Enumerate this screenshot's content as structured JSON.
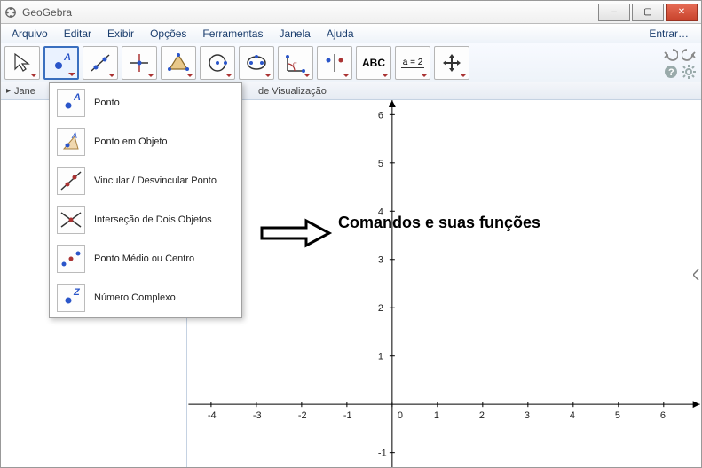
{
  "window": {
    "title": "GeoGebra",
    "min": "–",
    "max": "▢",
    "close": "✕"
  },
  "menu": {
    "items": [
      "Arquivo",
      "Editar",
      "Exibir",
      "Opções",
      "Ferramentas",
      "Janela",
      "Ajuda"
    ],
    "login": "Entrar…"
  },
  "toolbar": {
    "text_btn": "ABC",
    "slider_btn": "a = 2"
  },
  "panels": {
    "left_title": "Jane",
    "right_title": "de Visualização"
  },
  "dropdown": {
    "items": [
      {
        "label": "Ponto",
        "icon": "point"
      },
      {
        "label": "Ponto em Objeto",
        "icon": "point-on-object"
      },
      {
        "label": "Vincular / Desvincular Ponto",
        "icon": "attach"
      },
      {
        "label": "Interseção de Dois Objetos",
        "icon": "intersect"
      },
      {
        "label": "Ponto Médio ou Centro",
        "icon": "midpoint"
      },
      {
        "label": "Número Complexo",
        "icon": "complex"
      }
    ]
  },
  "annotation": {
    "text": "Comandos e suas funções"
  },
  "chart_data": {
    "type": "scatter",
    "title": "",
    "xlabel": "",
    "ylabel": "",
    "xlim": [
      -4.5,
      6.8
    ],
    "ylim": [
      -1.3,
      6.3
    ],
    "xticks": [
      -4,
      -3,
      -2,
      -1,
      0,
      1,
      2,
      3,
      4,
      5,
      6
    ],
    "yticks": [
      -1,
      0,
      1,
      2,
      3,
      4,
      5,
      6
    ],
    "series": []
  }
}
